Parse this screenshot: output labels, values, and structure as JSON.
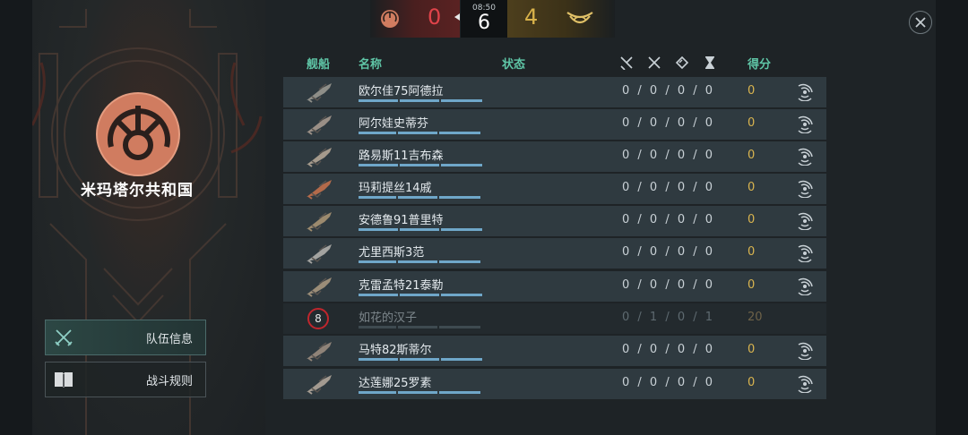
{
  "scoreboard": {
    "team_red_score": "0",
    "time": "08:50",
    "round": "6",
    "team_gold_score": "4"
  },
  "sidebar": {
    "faction_name": "米玛塔尔共和国",
    "buttons": [
      {
        "label": "队伍信息",
        "icon": "crossed-swords-icon",
        "active": true
      },
      {
        "label": "战斗规则",
        "icon": "book-icon",
        "active": false
      }
    ]
  },
  "table": {
    "headers": {
      "ship": "舰船",
      "name": "名称",
      "status": "状态",
      "kills_icon": "kill-icon",
      "deaths_icon": "crossed-swords-icon",
      "objective_icon": "diamond-icon",
      "time_icon": "hourglass-icon",
      "score": "得分"
    },
    "rows": [
      {
        "name": "欧尔佳75阿德拉",
        "stats": "0 / 0 / 0 / 0",
        "score": "0",
        "dead": false,
        "ship_color": "#8e8e88"
      },
      {
        "name": "阿尔娃史蒂芬",
        "stats": "0 / 0 / 0 / 0",
        "score": "0",
        "dead": false,
        "ship_color": "#9a8f86"
      },
      {
        "name": "路易斯11吉布森",
        "stats": "0 / 0 / 0 / 0",
        "score": "0",
        "dead": false,
        "ship_color": "#a59a8c"
      },
      {
        "name": "玛莉提丝14戚",
        "stats": "0 / 0 / 0 / 0",
        "score": "0",
        "dead": false,
        "ship_color": "#b36a4a"
      },
      {
        "name": "安德鲁91普里特",
        "stats": "0 / 0 / 0 / 0",
        "score": "0",
        "dead": false,
        "ship_color": "#9c8a6e"
      },
      {
        "name": "尤里西斯3范",
        "stats": "0 / 0 / 0 / 0",
        "score": "0",
        "dead": false,
        "ship_color": "#a3a3a0"
      },
      {
        "name": "克雷孟特21泰勒",
        "stats": "0 / 0 / 0 / 0",
        "score": "0",
        "dead": false,
        "ship_color": "#9b8d78"
      },
      {
        "name": "如花的汉子",
        "stats": "0 / 1 / 0 / 1",
        "score": "20",
        "dead": true,
        "rank": "8"
      },
      {
        "name": "马特82斯蒂尔",
        "stats": "0 / 0 / 0 / 0",
        "score": "0",
        "dead": false,
        "ship_color": "#8f8378"
      },
      {
        "name": "达莲娜25罗素",
        "stats": "0 / 0 / 0 / 0",
        "score": "0",
        "dead": false,
        "ship_color": "#a39a90"
      }
    ]
  }
}
